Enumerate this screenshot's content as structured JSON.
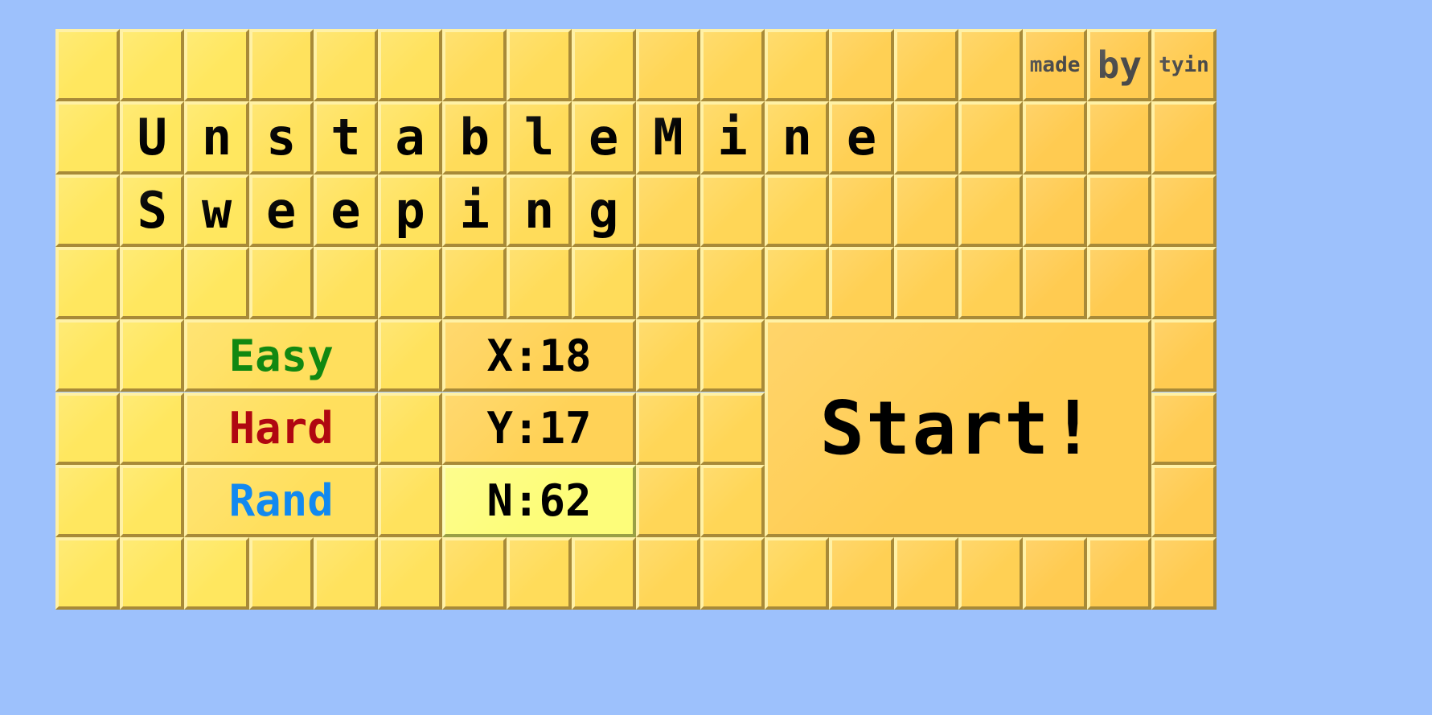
{
  "app": {
    "name": "Unstable Mine Sweeping",
    "background_color": "#9dc1fc",
    "cell_color": "#ffdf5e",
    "cell_highlight_color": "#fff1a6",
    "cell_shadow_color": "#a88a38"
  },
  "credit": {
    "made": "made",
    "by": "by",
    "author": "tyin"
  },
  "title": {
    "line1": "UnstableMine",
    "line2": "Sweeping",
    "line1_letters": [
      "U",
      "n",
      "s",
      "t",
      "a",
      "b",
      "l",
      "e",
      "M",
      "i",
      "n",
      "e"
    ],
    "line2_letters": [
      "S",
      "w",
      "e",
      "e",
      "p",
      "i",
      "n",
      "g"
    ]
  },
  "controls": {
    "difficulty": [
      {
        "label": "Easy",
        "color": "#118811"
      },
      {
        "label": "Hard",
        "color": "#b00711"
      },
      {
        "label": "Rand",
        "color": "#1289f0"
      }
    ],
    "fields": [
      {
        "label": "X:18",
        "key": "X",
        "value": "18",
        "active": false
      },
      {
        "label": "Y:17",
        "key": "Y",
        "value": "17",
        "active": false
      },
      {
        "label": "N:62",
        "key": "N",
        "value": "62",
        "active": true
      }
    ],
    "start_label": "Start!"
  },
  "grid": {
    "columns": 18,
    "rows": 8
  }
}
